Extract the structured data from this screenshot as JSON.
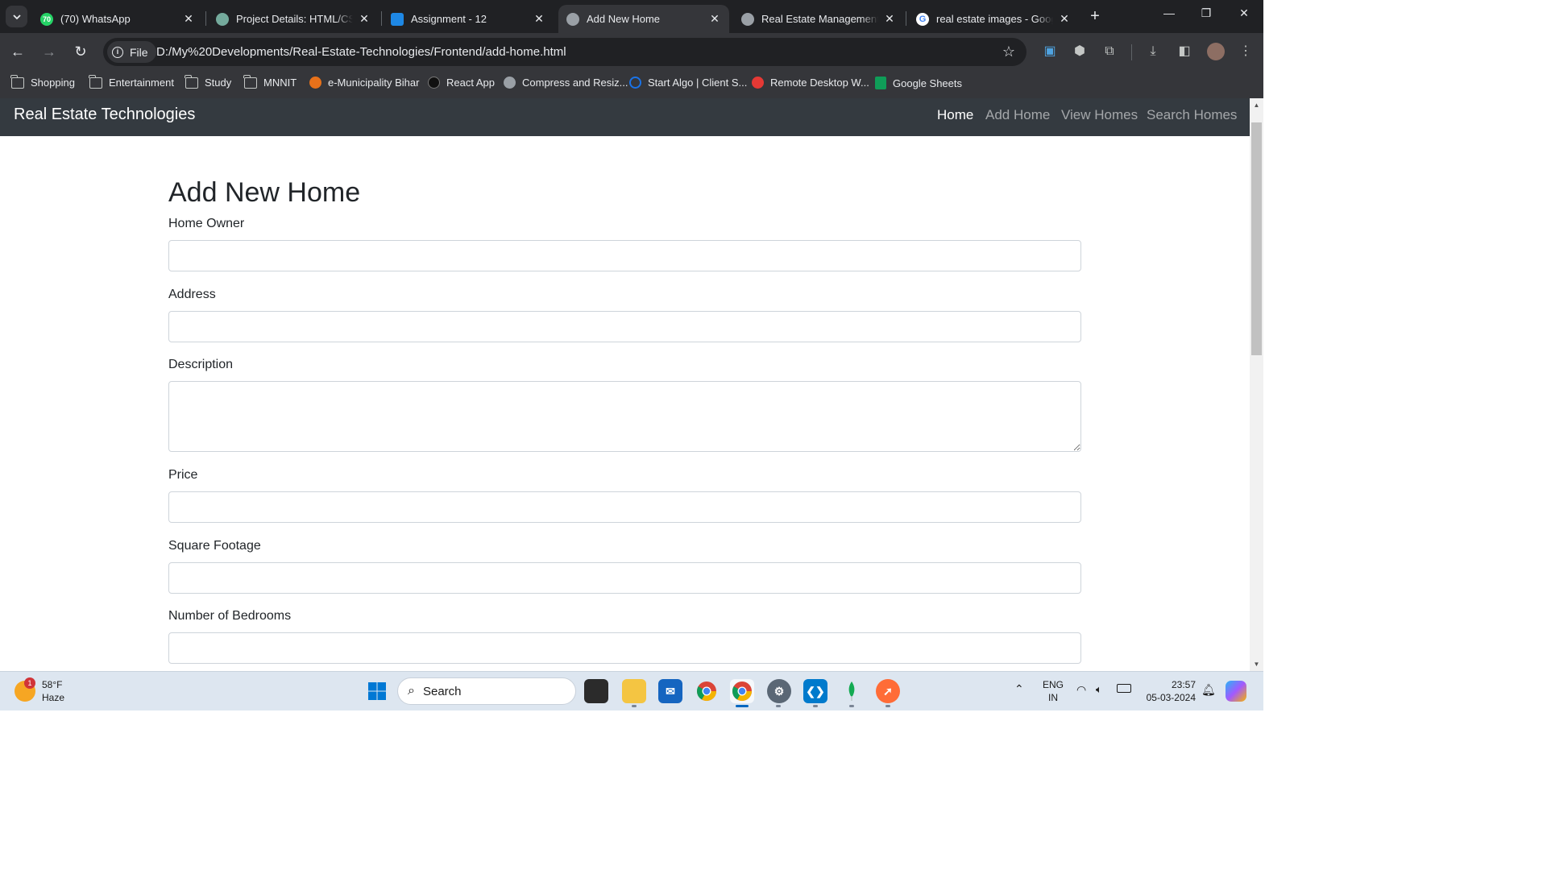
{
  "browser": {
    "tabs": [
      {
        "title": "(70) WhatsApp",
        "favicon": "whatsapp-icon",
        "color": "#25d366",
        "badge": "70"
      },
      {
        "title": "Project Details: HTML/CSS/",
        "favicon": "chatgpt-icon",
        "color": "#74aa9c"
      },
      {
        "title": "Assignment - 12",
        "favicon": "classroom-icon",
        "color": "#1e88e5"
      },
      {
        "title": "Add New Home",
        "favicon": "globe-icon",
        "color": "#9aa0a6",
        "active": true
      },
      {
        "title": "Real Estate Management S",
        "favicon": "globe-icon",
        "color": "#9aa0a6"
      },
      {
        "title": "real estate images - Googl",
        "favicon": "google-icon",
        "color": "#4285f4"
      }
    ],
    "address": {
      "chip_label": "File",
      "url": "D:/My%20Developments/Real-Estate-Technologies/Frontend/add-home.html"
    },
    "bookmarks": [
      {
        "label": "Shopping",
        "icon": "folder-icon"
      },
      {
        "label": "Entertainment",
        "icon": "folder-icon"
      },
      {
        "label": "Study",
        "icon": "folder-icon"
      },
      {
        "label": "MNNIT",
        "icon": "folder-icon"
      },
      {
        "label": "e-Municipality Bihar",
        "icon": "site-icon",
        "color": "#e8711a"
      },
      {
        "label": "React App",
        "icon": "react-icon",
        "color": "#111111"
      },
      {
        "label": "Compress and Resiz...",
        "icon": "globe-icon",
        "color": "#9aa0a6"
      },
      {
        "label": "Start Algo | Client S...",
        "icon": "site-icon",
        "color": "#1a73e8"
      },
      {
        "label": "Remote Desktop W...",
        "icon": "remote-desktop-icon",
        "color": "#e53935"
      },
      {
        "label": "Google Sheets",
        "icon": "sheets-icon",
        "color": "#0f9d58"
      }
    ]
  },
  "site": {
    "brand": "Real Estate Technologies",
    "nav": [
      {
        "label": "Home",
        "active": true
      },
      {
        "label": "Add Home"
      },
      {
        "label": "View Homes"
      },
      {
        "label": "Search Homes"
      }
    ],
    "heading": "Add New Home",
    "fields": [
      {
        "label": "Home Owner",
        "type": "text",
        "value": ""
      },
      {
        "label": "Address",
        "type": "text",
        "value": ""
      },
      {
        "label": "Description",
        "type": "textarea",
        "value": ""
      },
      {
        "label": "Price",
        "type": "text",
        "value": ""
      },
      {
        "label": "Square Footage",
        "type": "text",
        "value": ""
      },
      {
        "label": "Number of Bedrooms",
        "type": "text",
        "value": ""
      }
    ],
    "colors": {
      "navbar": "#343a40",
      "text": "#212529"
    }
  },
  "taskbar": {
    "weather": {
      "temp": "58°F",
      "condition": "Haze",
      "badge": "1"
    },
    "search_placeholder": "Search",
    "apps": [
      "windows-start-icon",
      "terminal-icon",
      "file-explorer-icon",
      "mail-icon",
      "chrome-icon",
      "chrome-icon",
      "settings-icon",
      "vscode-icon",
      "mongodb-icon",
      "postman-icon"
    ],
    "tray": {
      "lang_top": "ENG",
      "lang_bottom": "IN"
    },
    "clock": {
      "time": "23:57",
      "date": "05-03-2024"
    }
  }
}
